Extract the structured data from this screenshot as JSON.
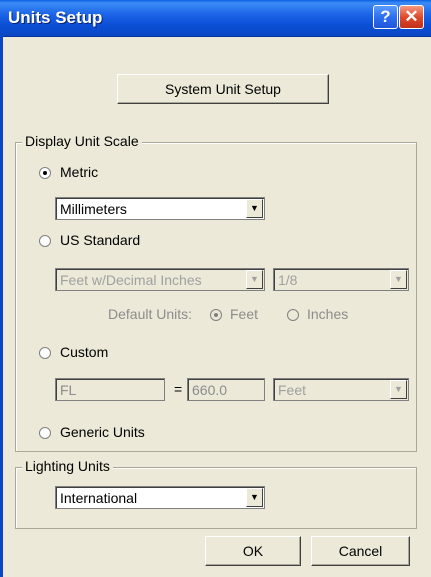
{
  "window": {
    "title": "Units Setup",
    "help_icon": "?",
    "close_icon": "✕"
  },
  "system_unit_setup_label": "System Unit Setup",
  "display_unit_scale": {
    "legend": "Display Unit Scale",
    "metric": {
      "label": "Metric",
      "selected": true,
      "value": "Millimeters"
    },
    "us_standard": {
      "label": "US Standard",
      "selected": false,
      "value": "Feet w/Decimal Inches",
      "fraction": "1/8",
      "default_units_label": "Default Units:",
      "feet_label": "Feet",
      "inches_label": "Inches"
    },
    "custom": {
      "label": "Custom",
      "selected": false,
      "name": "FL",
      "equals": "=",
      "value": "660.0",
      "unit": "Feet"
    },
    "generic": {
      "label": "Generic Units",
      "selected": false
    }
  },
  "lighting_units": {
    "legend": "Lighting Units",
    "value": "International"
  },
  "buttons": {
    "ok": "OK",
    "cancel": "Cancel"
  },
  "dropdown_arrow": "▼"
}
